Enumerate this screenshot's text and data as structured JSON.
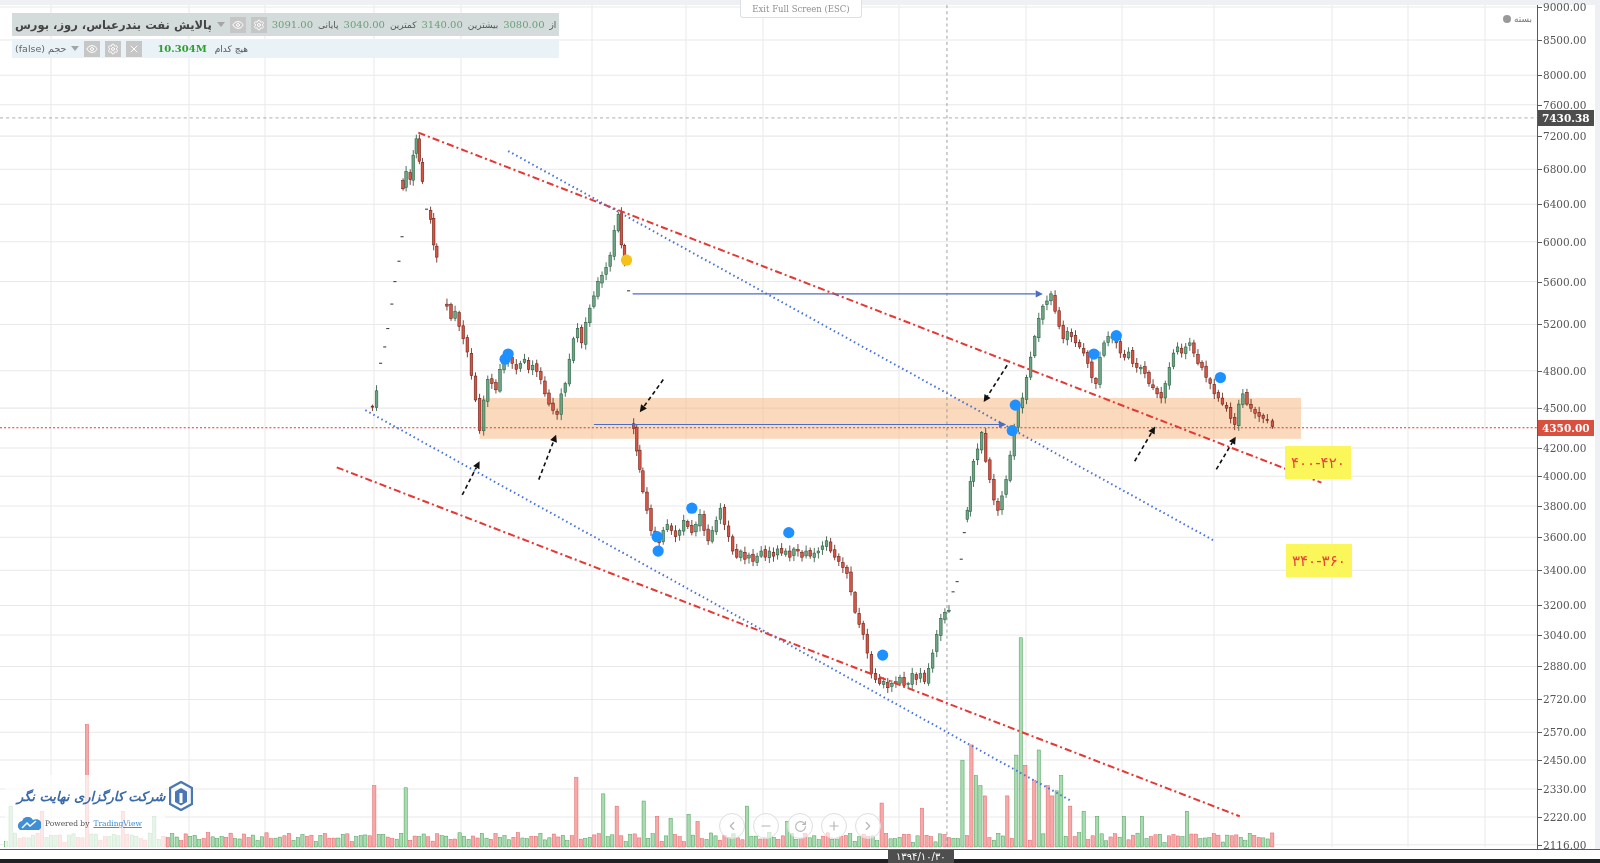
{
  "toolbar": {
    "exit_button": "Exit Full Screen (ESC)"
  },
  "legend": {
    "title": "پالایش نفت بندرعباس، روز، بورس",
    "ohlc": [
      {
        "kind": "value",
        "text": "3091.00"
      },
      {
        "kind": "label",
        "text": "پایانی"
      },
      {
        "kind": "value",
        "text": "3040.00"
      },
      {
        "kind": "label",
        "text": "کمترین"
      },
      {
        "kind": "value",
        "text": "3140.00"
      },
      {
        "kind": "label",
        "text": "بیشترین"
      },
      {
        "kind": "value",
        "text": "3080.00"
      },
      {
        "kind": "label",
        "text": "از"
      }
    ]
  },
  "volume_legend": {
    "title": "حجم (false)",
    "value": "10.304M",
    "label": "هیچ کدام"
  },
  "market_status": "بسته",
  "annotations": [
    {
      "text": "۴۰۰-۴۲۰"
    },
    {
      "text": "۳۴۰-۳۶۰"
    }
  ],
  "price_axis": {
    "labels": [
      "9000.00",
      "8500.00",
      "8000.00",
      "7600.00",
      "7200.00",
      "6800.00",
      "6400.00",
      "6000.00",
      "5600.00",
      "5200.00",
      "4800.00",
      "4500.00",
      "4200.00",
      "4000.00",
      "3800.00",
      "3600.00",
      "3400.00",
      "3200.00",
      "3040.00",
      "2880.00",
      "2720.00",
      "2570.00",
      "2450.00",
      "2330.00",
      "2220.00",
      "2116.00"
    ],
    "high_label": "7430.38",
    "last_label": "4350.00"
  },
  "time_axis": {
    "crosshair_label": "۱۳۹۴/۱۰/۳۰"
  },
  "branding": {
    "broker": "شرکت کارگزاری نهایت نگر",
    "powered_by": "Powered by",
    "link": "TradingView"
  }
}
